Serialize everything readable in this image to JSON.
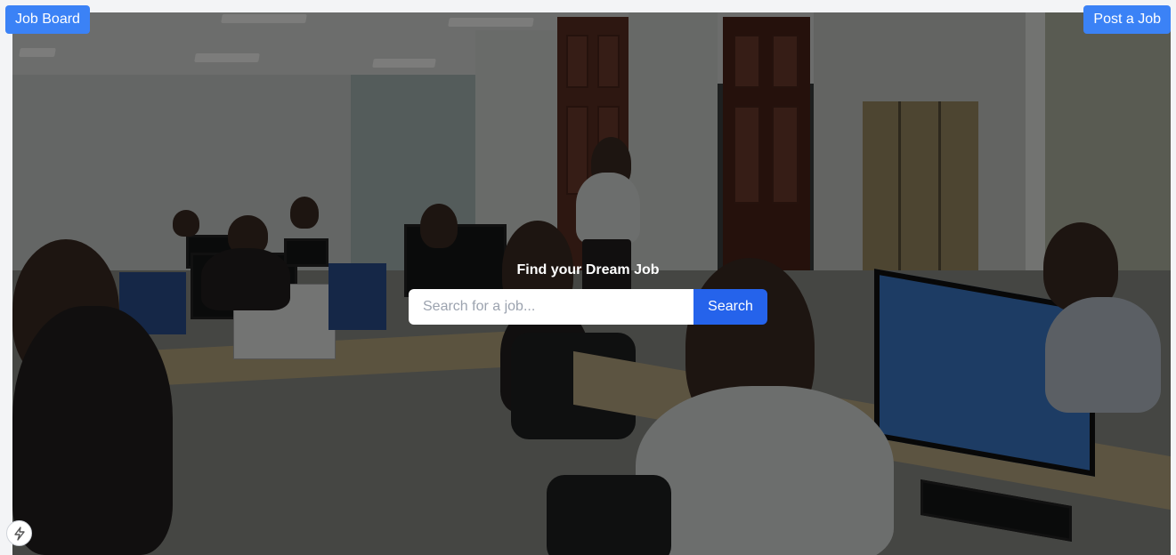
{
  "header": {
    "brand_label": "Job Board",
    "post_job_label": "Post a Job"
  },
  "hero": {
    "background": "office-photo",
    "headline": "Find your Dream Job",
    "search": {
      "placeholder": "Search for a job...",
      "value": "",
      "button_label": "Search"
    }
  },
  "footer": {
    "badge_icon": "lightning-bolt-icon"
  },
  "colors": {
    "nav_button": "#3b82f6",
    "search_button": "#2563eb",
    "page_background": "#f3f4f6",
    "headline_text": "#ffffff"
  }
}
